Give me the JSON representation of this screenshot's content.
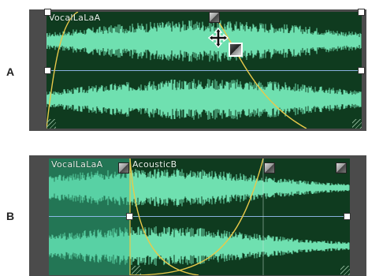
{
  "panel_a": {
    "label": "A",
    "clip": {
      "name": "VocalLaLaA"
    }
  },
  "panel_b": {
    "label": "B",
    "clip_left": {
      "name": "VocalLaLaA"
    },
    "clip_right": {
      "name": "AcousticB"
    }
  },
  "colors": {
    "waveform": "#6fe0b0",
    "clip_bg": "#0f3b1f",
    "envelope": "#e8c94a",
    "track_bg": "#4b4b4b"
  },
  "icons": [
    "move-cursor-icon",
    "fade-handle-icon",
    "crossfade-corner-icon"
  ]
}
